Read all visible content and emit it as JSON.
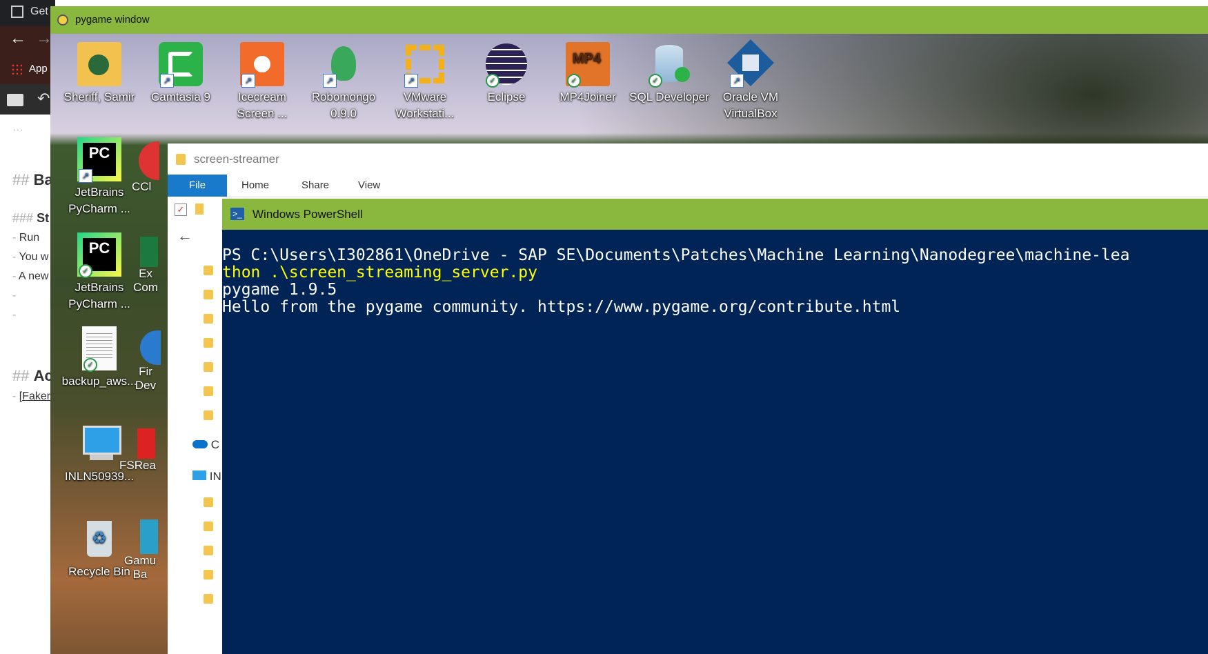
{
  "background_browser": {
    "tab_title": "Get",
    "bookmarks_label": "App",
    "markdown_lines": [
      {
        "text": "···"
      },
      {
        "hash": "##",
        "text": "Ba"
      },
      {
        "hash": "###",
        "text": "St"
      },
      {
        "hash": "-",
        "text": "Run"
      },
      {
        "hash": "-",
        "text": "You w"
      },
      {
        "hash": "-",
        "text": "A new"
      },
      {
        "hash": "-",
        "text": ""
      },
      {
        "hash": "-",
        "text": ""
      },
      {
        "hash": "##",
        "text": "Ac"
      },
      {
        "hash": "-",
        "text": "[Faker"
      }
    ]
  },
  "pygame_window": {
    "title": "pygame window"
  },
  "desktop": {
    "top_icons": [
      {
        "label": "Sheriff, Samir",
        "icon": "user-folder-icon",
        "badge": "none",
        "color": "#f2c14e"
      },
      {
        "label": "Camtasia 9",
        "icon": "camtasia-icon",
        "badge": "shortcut",
        "color": "#2bb34a"
      },
      {
        "label": "Icecream Screen ...",
        "icon": "icecream-screen-icon",
        "badge": "shortcut",
        "color": "#f26b2a"
      },
      {
        "label": "Robomongo 0.9.0",
        "icon": "robomongo-icon",
        "badge": "shortcut",
        "color": "#3aa85a"
      },
      {
        "label": "VMware Workstati...",
        "icon": "vmware-icon",
        "badge": "shortcut",
        "color": "#f3b21b"
      },
      {
        "label": "Eclipse",
        "icon": "eclipse-icon",
        "badge": "synced",
        "color": "#2c2255"
      },
      {
        "label": "MP4Joiner",
        "icon": "mp4joiner-icon",
        "badge": "synced",
        "color": "#e2742a"
      },
      {
        "label": "SQL Developer",
        "icon": "sql-developer-icon",
        "badge": "synced",
        "color": "#8fb6d6"
      },
      {
        "label": "Oracle VM VirtualBox",
        "icon": "virtualbox-icon",
        "badge": "shortcut",
        "color": "#1c5b9c"
      }
    ],
    "left_icons": [
      {
        "label": "JetBrains PyCharm ...",
        "icon": "pycharm-icon",
        "badge": "shortcut"
      },
      {
        "label": "JetBrains PyCharm ...",
        "icon": "pycharm-icon",
        "badge": "synced"
      },
      {
        "label": "backup_aws...",
        "icon": "text-file-icon",
        "badge": "synced"
      },
      {
        "label": "INLN50939...",
        "icon": "computer-icon",
        "badge": "none"
      },
      {
        "label": "Recycle Bin",
        "icon": "recycle-bin-icon",
        "badge": "none"
      }
    ],
    "partial_icons": [
      {
        "label": "CCl",
        "icon": "ccleaner-icon"
      },
      {
        "label": "Ex Com",
        "icon": "excel-compare-icon"
      },
      {
        "label": "Fir Dev",
        "icon": "firefox-dev-icon"
      },
      {
        "label": "FSRea",
        "icon": "fsreader-icon"
      },
      {
        "label": "Gamu Ba",
        "icon": "gamu-icon"
      }
    ]
  },
  "explorer": {
    "title": "screen-streamer",
    "ribbon_tabs": [
      "File",
      "Home",
      "Share",
      "View"
    ],
    "nav_items": [
      {
        "label": "C",
        "icon": "onedrive-icon"
      },
      {
        "label": "IN",
        "icon": "this-pc-icon"
      }
    ]
  },
  "powershell": {
    "title": "Windows PowerShell",
    "lines": [
      {
        "text": "PS C:\\Users\\I302861\\OneDrive - SAP SE\\Documents\\Patches\\Machine Learning\\Nanodegree\\machine-lea",
        "style": "normal"
      },
      {
        "text": "thon .\\screen_streaming_server.py",
        "style": "cmd"
      },
      {
        "text": "pygame 1.9.5",
        "style": "normal"
      },
      {
        "text": "Hello from the pygame community. https://www.pygame.org/contribute.html",
        "style": "normal"
      }
    ]
  }
}
